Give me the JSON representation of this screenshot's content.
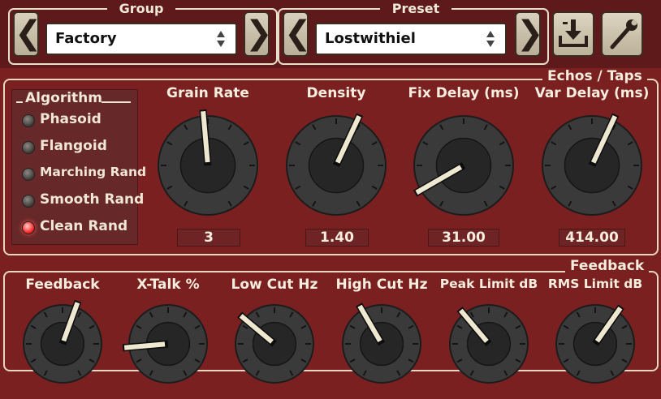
{
  "header": {
    "group": {
      "legend": "Group",
      "value": "Factory",
      "prev_glyph": "❮",
      "next_glyph": "❯"
    },
    "preset": {
      "legend": "Preset",
      "value": "Lostwithiel",
      "prev_glyph": "❮",
      "next_glyph": "❯"
    },
    "save_icon": "download-icon",
    "settings_icon": "wrench-icon"
  },
  "echos": {
    "legend": "Echos / Taps",
    "algorithm": {
      "title": "Algorithm",
      "items": [
        {
          "label": "Phasoid",
          "active": false
        },
        {
          "label": "Flangoid",
          "active": false
        },
        {
          "label": "Marching Rand",
          "active": false
        },
        {
          "label": "Smooth Rand",
          "active": false
        },
        {
          "label": "Clean Rand",
          "active": true
        }
      ]
    },
    "knobs": [
      {
        "label": "Grain Rate",
        "value": "3",
        "angle": -5
      },
      {
        "label": "Density",
        "value": "1.40",
        "angle": 25
      },
      {
        "label": "Fix Delay (ms)",
        "value": "31.00",
        "angle": -120
      },
      {
        "label": "Var Delay (ms)",
        "value": "414.00",
        "angle": 25
      }
    ]
  },
  "feedback": {
    "legend": "Feedback",
    "knobs": [
      {
        "label": "Feedback",
        "angle": 20
      },
      {
        "label": "X-Talk %",
        "angle": -95
      },
      {
        "label": "Low Cut Hz",
        "angle": -50
      },
      {
        "label": "High Cut Hz",
        "angle": -30
      },
      {
        "label": "Peak Limit dB",
        "angle": -40
      },
      {
        "label": "RMS Limit dB",
        "angle": 35
      }
    ]
  },
  "colors": {
    "panel": "#7a2020",
    "topbar": "#5e1a1a",
    "led_on": "#ff3a3a",
    "knob_body": "#2b2b2b",
    "pointer": "#efe8d0"
  }
}
